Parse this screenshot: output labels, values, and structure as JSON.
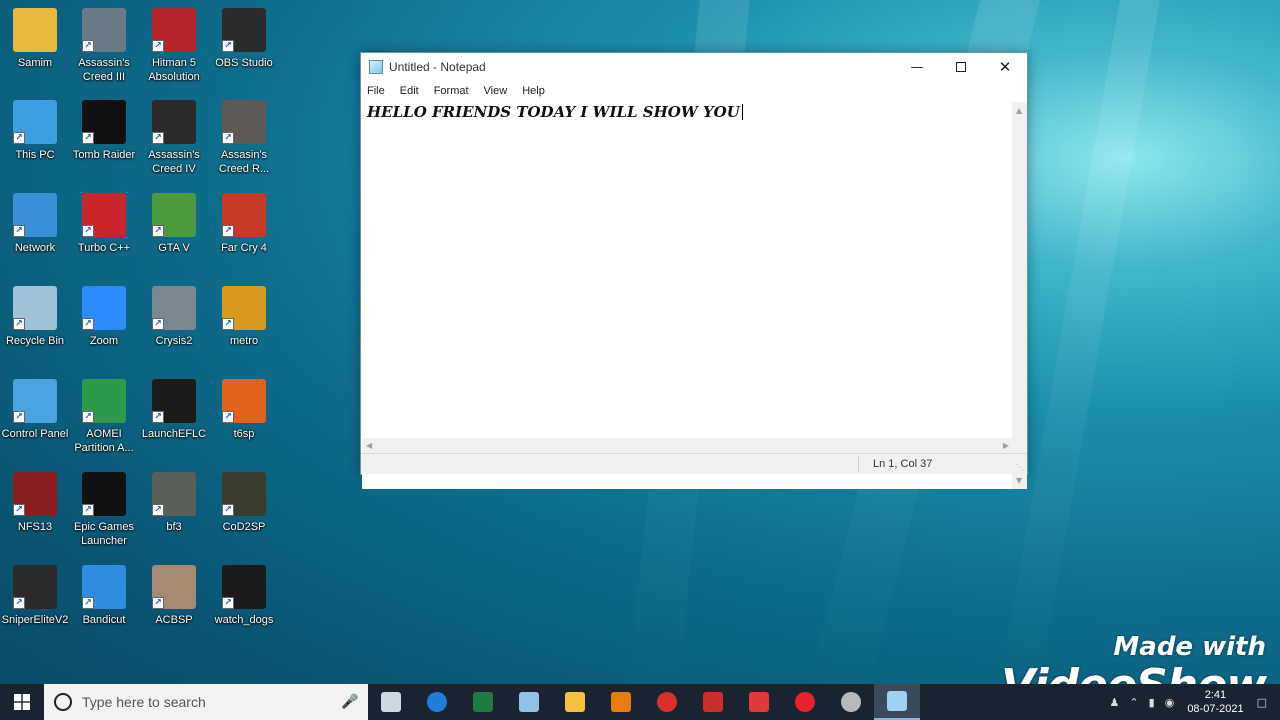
{
  "desktop": {
    "icons": [
      {
        "label": "Samim",
        "icon": "user-folder-icon",
        "color": "#e8b93a"
      },
      {
        "label": "Assassin's Creed III",
        "icon": "assassins-creed-3-icon",
        "color": "#6b7a86"
      },
      {
        "label": "Hitman 5 Absolution",
        "icon": "hitman-icon",
        "color": "#b8252a"
      },
      {
        "label": "OBS Studio",
        "icon": "obs-studio-icon",
        "color": "#2b2b2b"
      },
      {
        "label": "This PC",
        "icon": "this-pc-icon",
        "color": "#3ca0e0"
      },
      {
        "label": "Tomb Raider",
        "icon": "tomb-raider-icon",
        "color": "#111111"
      },
      {
        "label": "Assassin's Creed IV",
        "icon": "assassins-creed-4-icon",
        "color": "#2a2a2a"
      },
      {
        "label": "Assasin's Creed R...",
        "icon": "assassins-creed-r-icon",
        "color": "#5d5a55"
      },
      {
        "label": "Network",
        "icon": "network-icon",
        "color": "#3a8fd6"
      },
      {
        "label": "Turbo C++",
        "icon": "turbo-cpp-icon",
        "color": "#c8262b"
      },
      {
        "label": "GTA V",
        "icon": "gta-v-icon",
        "color": "#4c9a3a"
      },
      {
        "label": "Far Cry 4",
        "icon": "far-cry-4-icon",
        "color": "#c83a25"
      },
      {
        "label": "Recycle Bin",
        "icon": "recycle-bin-icon",
        "color": "#9ec3d8"
      },
      {
        "label": "Zoom",
        "icon": "zoom-icon",
        "color": "#2d8cff"
      },
      {
        "label": "Crysis2",
        "icon": "crysis2-icon",
        "color": "#7b8890"
      },
      {
        "label": "metro",
        "icon": "metro-icon",
        "color": "#d69a1e"
      },
      {
        "label": "Control Panel",
        "icon": "control-panel-icon",
        "color": "#4aa3df"
      },
      {
        "label": "AOMEI Partition A...",
        "icon": "aomei-icon",
        "color": "#2f9a4a"
      },
      {
        "label": "LaunchEFLC",
        "icon": "gta-iv-icon",
        "color": "#1b1b1b"
      },
      {
        "label": "t6sp",
        "icon": "black-ops-2-icon",
        "color": "#e2621b"
      },
      {
        "label": "NFS13",
        "icon": "nfs13-icon",
        "color": "#8a1d1d"
      },
      {
        "label": "Epic Games Launcher",
        "icon": "epic-games-icon",
        "color": "#111111"
      },
      {
        "label": "bf3",
        "icon": "bf3-icon",
        "color": "#5a5f5a"
      },
      {
        "label": "CoD2SP",
        "icon": "cod2-icon",
        "color": "#3c3c2e"
      },
      {
        "label": "SniperEliteV2",
        "icon": "sniper-elite-icon",
        "color": "#2a2a2a"
      },
      {
        "label": "Bandicut",
        "icon": "bandicut-icon",
        "color": "#2f8de0"
      },
      {
        "label": "ACBSP",
        "icon": "acbsp-icon",
        "color": "#a38a70"
      },
      {
        "label": "watch_dogs",
        "icon": "watch-dogs-icon",
        "color": "#1a1a1a"
      }
    ]
  },
  "notepad": {
    "title": "Untitled - Notepad",
    "menu": [
      "File",
      "Edit",
      "Format",
      "View",
      "Help"
    ],
    "content": "HELLO FRIENDS TODAY I WILL SHOW YOU",
    "status": "Ln 1, Col 37",
    "icon": "notepad-icon"
  },
  "taskbar": {
    "search_placeholder": "Type here to search",
    "apps": [
      {
        "name": "task-view-icon",
        "color": "#cfd8e0"
      },
      {
        "name": "edge-icon",
        "color": "#1e7fd8"
      },
      {
        "name": "excel-icon",
        "color": "#1f7a44"
      },
      {
        "name": "paint-icon",
        "color": "#8fc3e6"
      },
      {
        "name": "file-explorer-icon",
        "color": "#f3c33d"
      },
      {
        "name": "blender-icon",
        "color": "#e87d0d"
      },
      {
        "name": "media-player-icon",
        "color": "#d8312a"
      },
      {
        "name": "screen-recorder-icon",
        "color": "#c9302c"
      },
      {
        "name": "network-app-icon",
        "color": "#e23a3a"
      },
      {
        "name": "opera-icon",
        "color": "#e8222b"
      },
      {
        "name": "obs-taskbar-icon",
        "color": "#b9b9b9"
      },
      {
        "name": "notepad-taskbar-icon",
        "color": "#9ed3ef"
      }
    ],
    "clock_time": "2:41",
    "clock_date": "08-07-2021"
  },
  "watermark": {
    "line1": "Made with",
    "line2": "VideoShow"
  }
}
